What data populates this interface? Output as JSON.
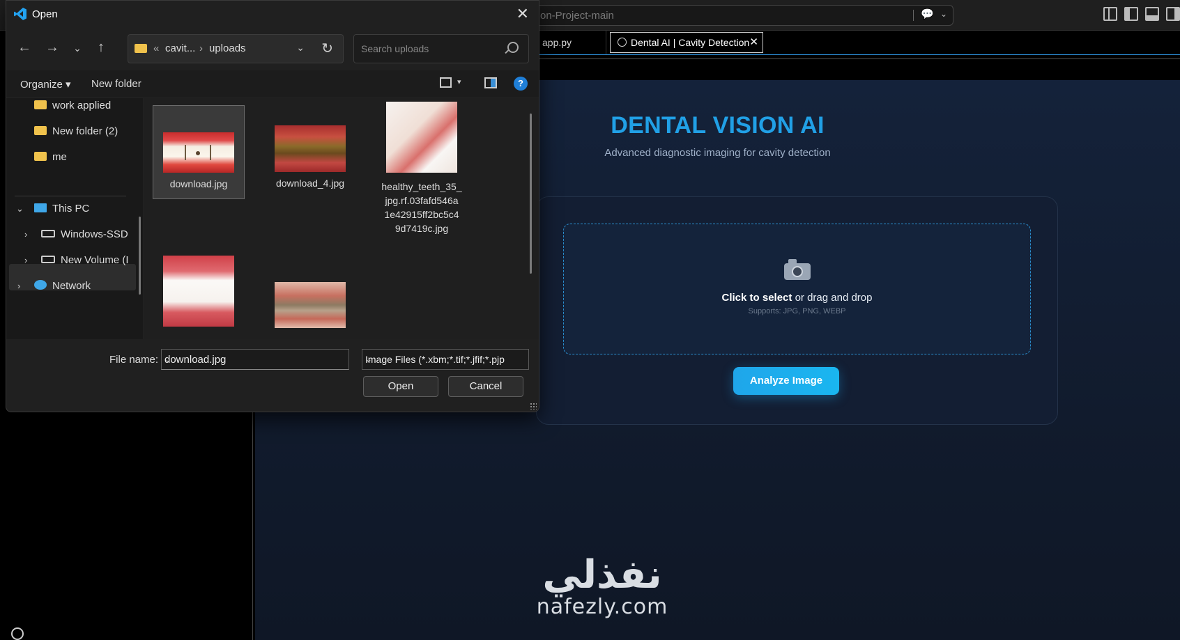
{
  "vscode": {
    "command_center_text": "on-Project-main",
    "tabs": [
      {
        "label": "app.py"
      },
      {
        "label": "Dental AI | Cavity Detection"
      }
    ]
  },
  "app": {
    "title": "DENTAL VISION AI",
    "subtitle": "Advanced diagnostic imaging for cavity detection",
    "drop_bold": "Click to select",
    "drop_rest": " or drag and drop",
    "drop_hint": "Supports: JPG, PNG, WEBP",
    "analyze_label": "Analyze Image",
    "accent": "#21a0e6"
  },
  "watermark": {
    "arabic": "نفذلي",
    "latin": "nafezly.com"
  },
  "dialog": {
    "title": "Open",
    "path": {
      "prefix": "«",
      "parent": "cavit...",
      "sep": "›",
      "current": "uploads"
    },
    "search_placeholder": "Search uploads",
    "organize_label": "Organize ▾",
    "new_folder_label": "New folder",
    "help_label": "?",
    "nav": {
      "folders": [
        "work  applied",
        "New folder (2)",
        "me"
      ],
      "this_pc": "This PC",
      "drives": [
        "Windows-SSD",
        "New Volume (I"
      ],
      "network": "Network"
    },
    "files": [
      {
        "name": "download.jpg",
        "selected": true
      },
      {
        "name": "download_4.jpg",
        "selected": false
      },
      {
        "name": "healthy_teeth_35_jpg.rf.03fafd546a1e42915ff2bc5c49d7419c.jpg",
        "lines": [
          "healthy_teeth_35_",
          "jpg.rf.03fafd546a",
          "1e42915ff2bc5c4",
          "9d7419c.jpg"
        ],
        "selected": false
      },
      {
        "name": "",
        "selected": false
      },
      {
        "name": "",
        "selected": false
      }
    ],
    "file_name_label": "File name:",
    "file_name_value": "download.jpg",
    "file_type_value": "Image Files (*.xbm;*.tif;*.jfif;*.pjp",
    "open_label": "Open",
    "cancel_label": "Cancel"
  }
}
